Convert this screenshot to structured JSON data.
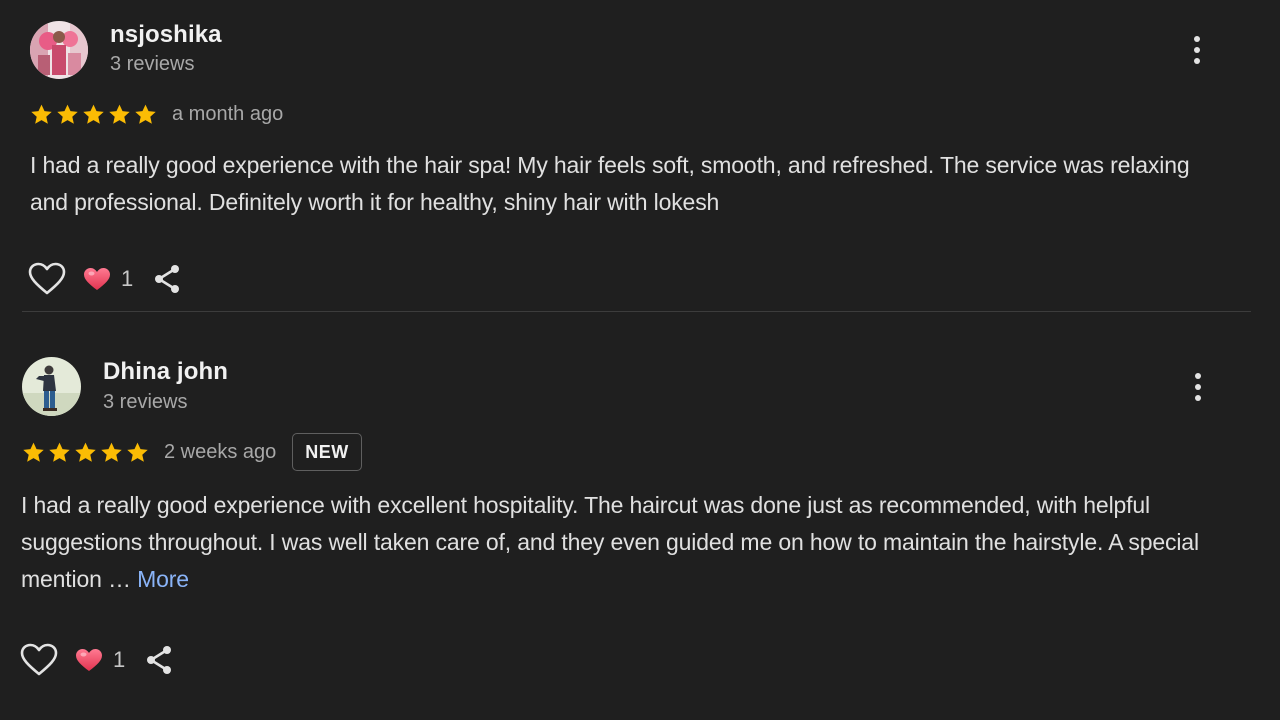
{
  "colors": {
    "background": "#1f1f1f",
    "star": "#fbbc04",
    "link": "#8ab4f8",
    "heart_fill": "#f0476b",
    "divider": "#3c3c3c"
  },
  "reviews": [
    {
      "author": "nsjoshika",
      "author_meta": "3 reviews",
      "rating": 5,
      "time": "a month ago",
      "badge": "",
      "text": "I had a really good experience with the hair spa! My hair feels soft, smooth, and refreshed. The service was relaxing and professional. Definitely worth it for healthy, shiny hair with lokesh",
      "more_label": "",
      "reaction_count": "1",
      "icons": {
        "like": "heart-outline-icon",
        "reaction": "heart-filled-icon",
        "share": "share-icon",
        "menu": "more-vertical-icon"
      }
    },
    {
      "author": "Dhina john",
      "author_meta": "3 reviews",
      "rating": 5,
      "time": "2 weeks ago",
      "badge": "NEW",
      "text": "I had a really good experience with excellent hospitality. The haircut was done just as recommended, with helpful suggestions throughout. I was well taken care of, and they even guided me on how to maintain the hairstyle. A special mention …",
      "more_label": "More",
      "reaction_count": "1",
      "icons": {
        "like": "heart-outline-icon",
        "reaction": "heart-filled-icon",
        "share": "share-icon",
        "menu": "more-vertical-icon"
      }
    }
  ]
}
